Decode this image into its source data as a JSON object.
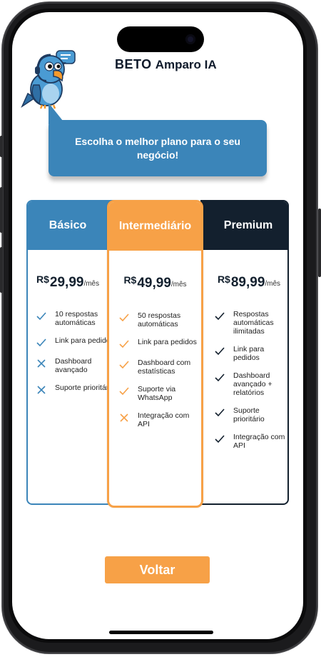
{
  "header": {
    "brand_bold": "BETO",
    "brand_rest": "Amparo IA"
  },
  "bubble": {
    "text": "Escolha o melhor plano para o seu negócio!"
  },
  "colors": {
    "blue": "#3b85b9",
    "orange": "#f7a147",
    "navy": "#13202e"
  },
  "plans": [
    {
      "name": "Básico",
      "currency": "R$",
      "price": "29,99",
      "period": "/mês",
      "features": [
        {
          "text": "10 respostas automáticas",
          "icon": "check-icon"
        },
        {
          "text": "Link para pedidos",
          "icon": "check-icon"
        },
        {
          "text": "Dashboard avançado",
          "icon": "cross-icon"
        },
        {
          "text": "Suporte prioritário",
          "icon": "cross-icon"
        }
      ]
    },
    {
      "name": "Intermediário",
      "currency": "R$",
      "price": "49,99",
      "period": "/mês",
      "features": [
        {
          "text": "50 respostas automáticas",
          "icon": "check-icon"
        },
        {
          "text": "Link para pedidos",
          "icon": "check-icon"
        },
        {
          "text": "Dashboard com estatísticas",
          "icon": "check-icon"
        },
        {
          "text": "Suporte via WhatsApp",
          "icon": "check-icon"
        },
        {
          "text": "Integração com API",
          "icon": "cross-icon"
        }
      ]
    },
    {
      "name": "Premium",
      "currency": "R$",
      "price": "89,99",
      "period": "/mês",
      "features": [
        {
          "text": "Respostas automáticas ilimitadas",
          "icon": "check-icon"
        },
        {
          "text": "Link para pedidos",
          "icon": "check-icon"
        },
        {
          "text": "Dashboard avançado + relatórios",
          "icon": "check-icon"
        },
        {
          "text": "Suporte prioritário",
          "icon": "check-icon"
        },
        {
          "text": "Integração com API",
          "icon": "check-icon"
        }
      ]
    }
  ],
  "actions": {
    "back_label": "Voltar"
  }
}
